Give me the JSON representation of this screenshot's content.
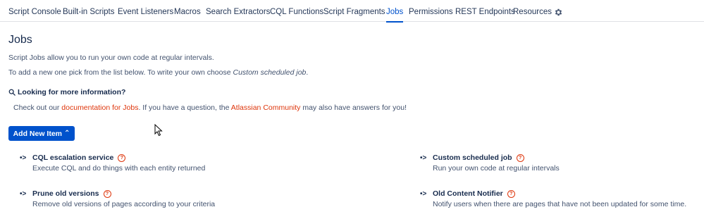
{
  "nav": {
    "tabs": [
      {
        "label": "Script Console"
      },
      {
        "label": "Built-in Scripts"
      },
      {
        "label": "Event Listeners"
      },
      {
        "label": "Macros"
      },
      {
        "label": "Search Extractors"
      },
      {
        "label": "CQL Functions"
      },
      {
        "label": "Script Fragments"
      },
      {
        "label": "Jobs",
        "active": true
      },
      {
        "label": "Permissions"
      },
      {
        "label": "REST Endpoints"
      },
      {
        "label": "Resources"
      }
    ],
    "settings_icon": "gear-icon"
  },
  "page": {
    "title": "Jobs",
    "intro": "Script Jobs allow you to run your own code at regular intervals.",
    "instruction_prefix": "To add a new one pick from the list below. To write your own choose ",
    "instruction_em": "Custom scheduled job",
    "instruction_suffix": "."
  },
  "info": {
    "heading": "Looking for more information?",
    "text_1": "Check out our ",
    "link_docs": "documentation for Jobs",
    "text_2": ". If you have a question, the ",
    "link_community": "Atlassian Community",
    "text_3": " may also have answers for you!"
  },
  "add_button": {
    "label": "Add New Item"
  },
  "items": [
    {
      "name": "CQL escalation service",
      "description": "Execute CQL and do things with each entity returned"
    },
    {
      "name": "Custom scheduled job",
      "description": "Run your own code at regular intervals"
    },
    {
      "name": "Prune old versions",
      "description": "Remove old versions of pages according to your criteria"
    },
    {
      "name": "Old Content Notifier",
      "description": "Notify users when there are pages that have not been updated for some time."
    }
  ],
  "colors": {
    "accent": "#0052cc",
    "link": "#de350b",
    "text": "#172b4d"
  }
}
